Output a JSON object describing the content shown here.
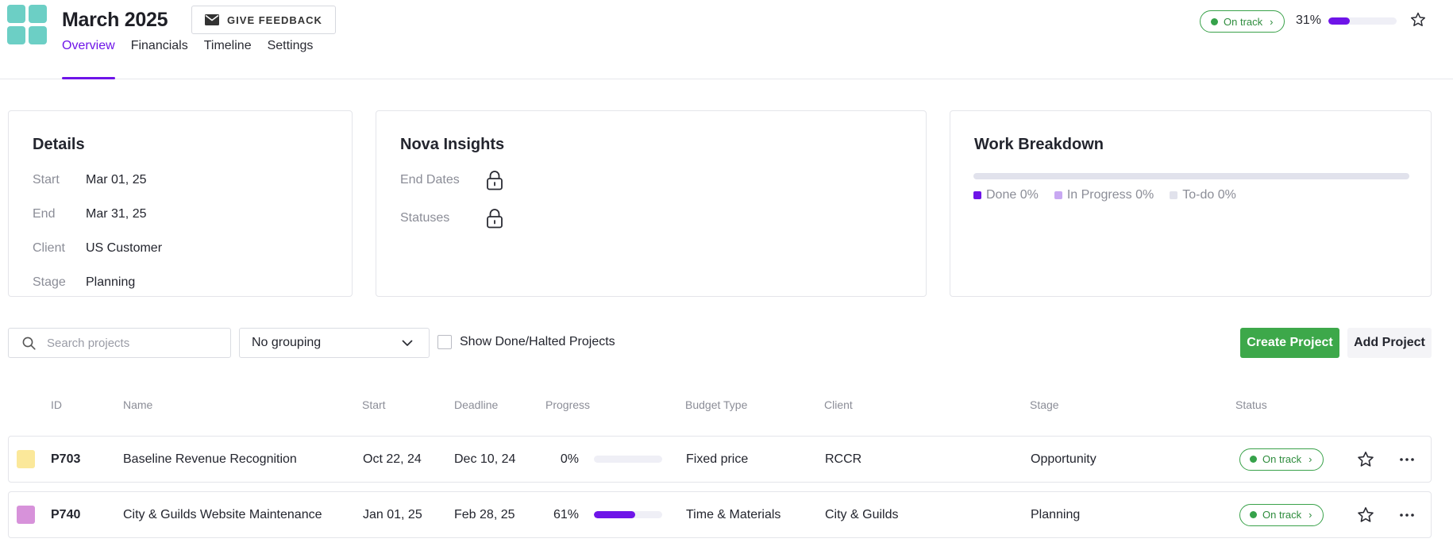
{
  "header": {
    "title": "March 2025",
    "feedback_label": "GIVE FEEDBACK",
    "tabs": [
      {
        "label": "Overview",
        "active": true
      },
      {
        "label": "Financials",
        "active": false
      },
      {
        "label": "Timeline",
        "active": false
      },
      {
        "label": "Settings",
        "active": false
      }
    ],
    "status": "On track",
    "progress_label": "31%",
    "progress_value": 0.31
  },
  "details": {
    "title": "Details",
    "rows": [
      {
        "key": "Start",
        "value": "Mar 01, 25"
      },
      {
        "key": "End",
        "value": "Mar 31, 25"
      },
      {
        "key": "Client",
        "value": "US Customer"
      },
      {
        "key": "Stage",
        "value": "Planning"
      }
    ]
  },
  "insights": {
    "title": "Nova Insights",
    "rows": [
      {
        "key": "End Dates",
        "icon": "lock-icon"
      },
      {
        "key": "Statuses",
        "icon": "lock-icon"
      }
    ]
  },
  "work": {
    "title": "Work Breakdown",
    "legend": [
      {
        "label": "Done 0%",
        "color": "#6e14e8"
      },
      {
        "label": "In Progress 0%",
        "color": "#c8a8f2"
      },
      {
        "label": "To-do 0%",
        "color": "#e1e2ec"
      }
    ]
  },
  "toolbar": {
    "search_placeholder": "Search projects",
    "grouping": "No grouping",
    "show_done_label": "Show Done/Halted Projects",
    "create_label": "Create Project",
    "add_label": "Add Project"
  },
  "table": {
    "columns": {
      "id": "ID",
      "name": "Name",
      "start": "Start",
      "deadline": "Deadline",
      "progress": "Progress",
      "budget": "Budget Type",
      "client": "Client",
      "stage": "Stage",
      "status": "Status"
    },
    "rows": [
      {
        "color": "#fbe89a",
        "id": "P703",
        "name": "Baseline Revenue Recognition",
        "start": "Oct 22, 24",
        "deadline": "Dec 10, 24",
        "progress_label": "0%",
        "progress": 0.0,
        "budget": "Fixed price",
        "client": "RCCR",
        "stage": "Opportunity",
        "status": "On track"
      },
      {
        "color": "#d792da",
        "id": "P740",
        "name": "City & Guilds Website Maintenance",
        "start": "Jan 01, 25",
        "deadline": "Feb 28, 25",
        "progress_label": "61%",
        "progress": 0.61,
        "budget": "Time & Materials",
        "client": "City & Guilds",
        "stage": "Planning",
        "status": "On track"
      }
    ]
  },
  "colors": {
    "accent": "#6e14e8",
    "success": "#3da84a",
    "logo": "#6ccfc5"
  }
}
